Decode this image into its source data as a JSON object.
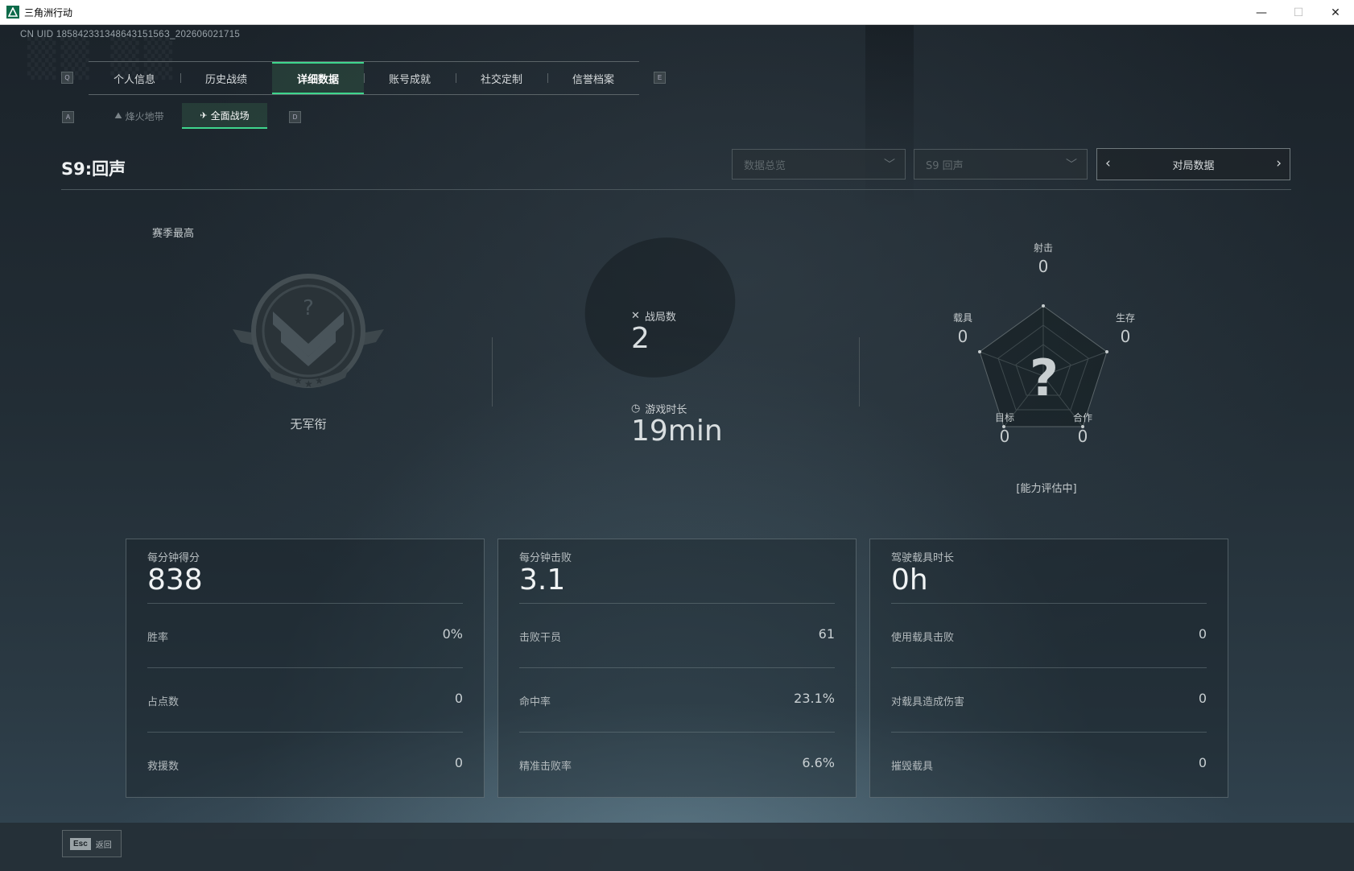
{
  "window": {
    "title": "三角洲行动",
    "minimize": "—",
    "maximize": "☐",
    "close": "✕"
  },
  "uid": "CN UID 18584233134864315156З_202606021715",
  "tabs": {
    "key_left": "Q",
    "key_right": "E",
    "items": [
      "个人信息",
      "历史战绩",
      "详细数据",
      "账号成就",
      "社交定制",
      "信誉档案"
    ],
    "active": "详细数据"
  },
  "subtabs": {
    "key_left": "A",
    "key_right": "D",
    "items": [
      {
        "label": "烽火地带",
        "icon": "mountain-icon"
      },
      {
        "label": "全面战场",
        "icon": "jet-icon"
      }
    ],
    "active": "全面战场"
  },
  "season": {
    "title": "S9:回声"
  },
  "filters": {
    "overview": "数据总览",
    "season": "S9 回声",
    "match_data": "对局数据"
  },
  "rank": {
    "season_best_label": "赛季最高",
    "rank_name": "无军衔",
    "emblem_mark": "?"
  },
  "overview": {
    "matches_label": "战局数",
    "matches_value": "2",
    "playtime_label": "游戏时长",
    "playtime_value": "19min"
  },
  "radar": {
    "center_mark": "?",
    "axes": [
      {
        "label": "射击",
        "value": "0"
      },
      {
        "label": "生存",
        "value": "0"
      },
      {
        "label": "合作",
        "value": "0"
      },
      {
        "label": "目标",
        "value": "0"
      },
      {
        "label": "载具",
        "value": "0"
      }
    ],
    "status": "[能力评估中]"
  },
  "cards": [
    {
      "label": "每分钟得分",
      "value": "838",
      "rows": [
        {
          "label": "胜率",
          "value": "0%"
        },
        {
          "label": "占点数",
          "value": "0"
        },
        {
          "label": "救援数",
          "value": "0"
        }
      ]
    },
    {
      "label": "每分钟击败",
      "value": "3.1",
      "rows": [
        {
          "label": "击败干员",
          "value": "61"
        },
        {
          "label": "命中率",
          "value": "23.1%"
        },
        {
          "label": "精准击败率",
          "value": "6.6%"
        }
      ]
    },
    {
      "label": "驾驶载具时长",
      "value": "0h",
      "rows": [
        {
          "label": "使用载具击败",
          "value": "0"
        },
        {
          "label": "对载具造成伤害",
          "value": "0"
        },
        {
          "label": "摧毁载具",
          "value": "0"
        }
      ]
    }
  ],
  "footer": {
    "esc_key": "Esc",
    "back_label": "返回"
  },
  "colors": {
    "accent": "#3ed68d",
    "background": "#1c252d"
  }
}
